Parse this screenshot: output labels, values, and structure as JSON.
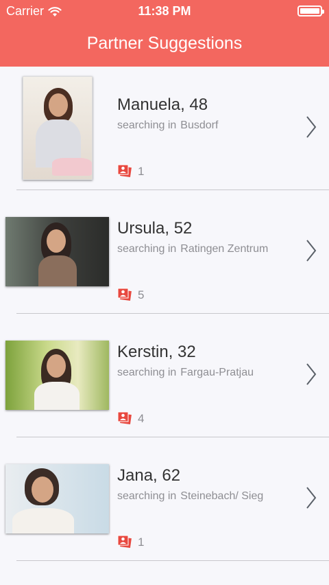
{
  "status_bar": {
    "carrier": "Carrier",
    "time": "11:38 PM"
  },
  "nav": {
    "title": "Partner Suggestions"
  },
  "colors": {
    "accent": "#f3675f",
    "photo_icon": "#e8483f"
  },
  "suggestions": [
    {
      "name": "Manuela, 48",
      "searching_label": "searching in",
      "location": "Busdorf",
      "photo_count": "1"
    },
    {
      "name": "Ursula, 52",
      "searching_label": "searching in",
      "location": "Ratingen Zentrum",
      "photo_count": "5"
    },
    {
      "name": "Kerstin, 32",
      "searching_label": "searching in",
      "location": "Fargau-Pratjau",
      "photo_count": "4"
    },
    {
      "name": "Jana, 62",
      "searching_label": "searching in",
      "location": "Steinebach/ Sieg",
      "photo_count": "1"
    }
  ]
}
